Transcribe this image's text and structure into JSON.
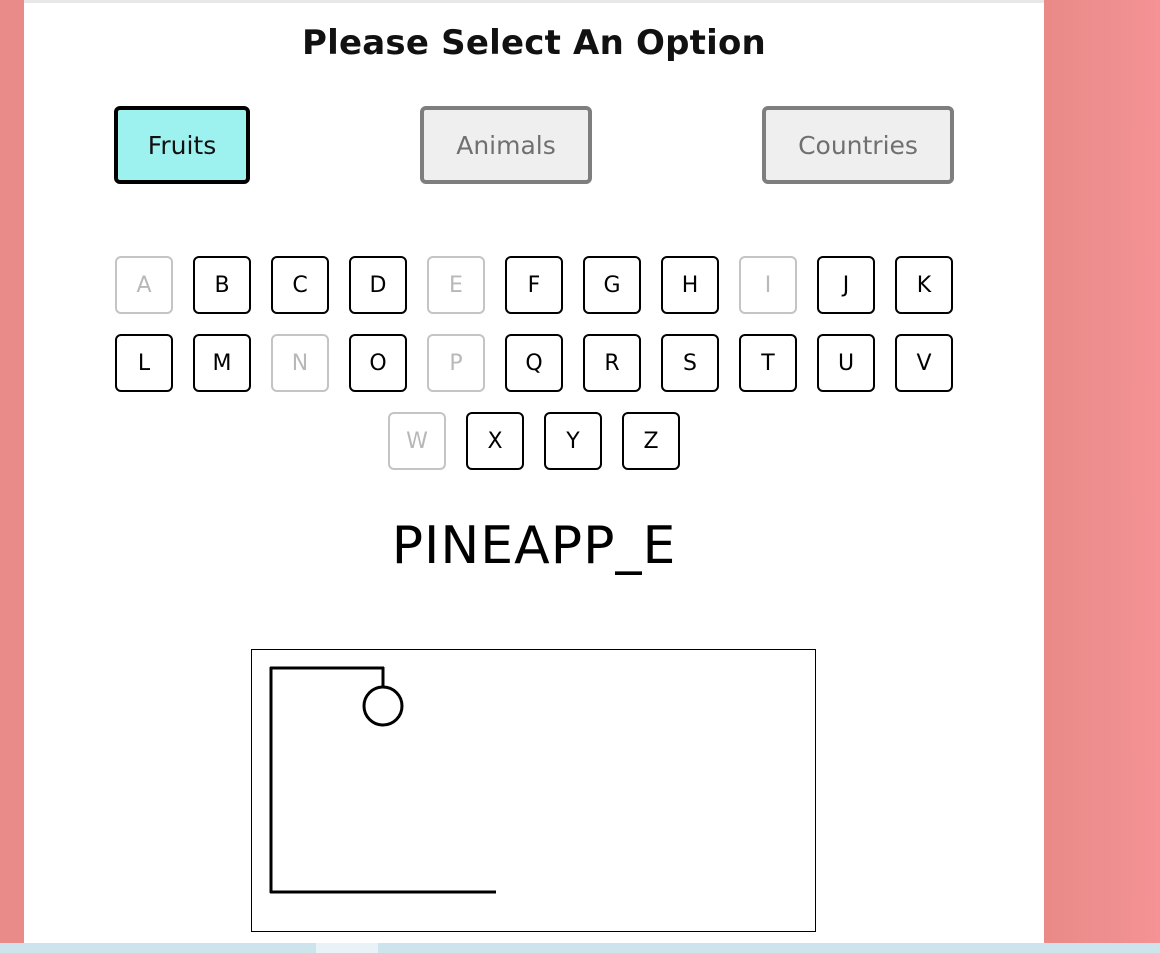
{
  "title": "Please Select An Option",
  "options": [
    {
      "label": "Fruits",
      "selected": true
    },
    {
      "label": "Animals",
      "selected": false
    },
    {
      "label": "Countries",
      "selected": false
    }
  ],
  "letters": {
    "row1": [
      {
        "char": "A",
        "disabled": true
      },
      {
        "char": "B",
        "disabled": false
      },
      {
        "char": "C",
        "disabled": false
      },
      {
        "char": "D",
        "disabled": false
      },
      {
        "char": "E",
        "disabled": true
      },
      {
        "char": "F",
        "disabled": false
      },
      {
        "char": "G",
        "disabled": false
      },
      {
        "char": "H",
        "disabled": false
      },
      {
        "char": "I",
        "disabled": true
      },
      {
        "char": "J",
        "disabled": false
      },
      {
        "char": "K",
        "disabled": false
      }
    ],
    "row2": [
      {
        "char": "L",
        "disabled": false
      },
      {
        "char": "M",
        "disabled": false
      },
      {
        "char": "N",
        "disabled": true
      },
      {
        "char": "O",
        "disabled": false
      },
      {
        "char": "P",
        "disabled": true
      },
      {
        "char": "Q",
        "disabled": false
      },
      {
        "char": "R",
        "disabled": false
      },
      {
        "char": "S",
        "disabled": false
      },
      {
        "char": "T",
        "disabled": false
      },
      {
        "char": "U",
        "disabled": false
      },
      {
        "char": "V",
        "disabled": false
      }
    ],
    "row3": [
      {
        "char": "W",
        "disabled": true
      },
      {
        "char": "X",
        "disabled": false
      },
      {
        "char": "Y",
        "disabled": false
      },
      {
        "char": "Z",
        "disabled": false
      }
    ]
  },
  "word_display": "PINEAPP_E",
  "hangman": {
    "parts_drawn": [
      "base",
      "pole",
      "beam",
      "rope",
      "head"
    ]
  },
  "colors": {
    "selected_option_bg": "#9df1ee",
    "page_background": "#e98c89"
  }
}
